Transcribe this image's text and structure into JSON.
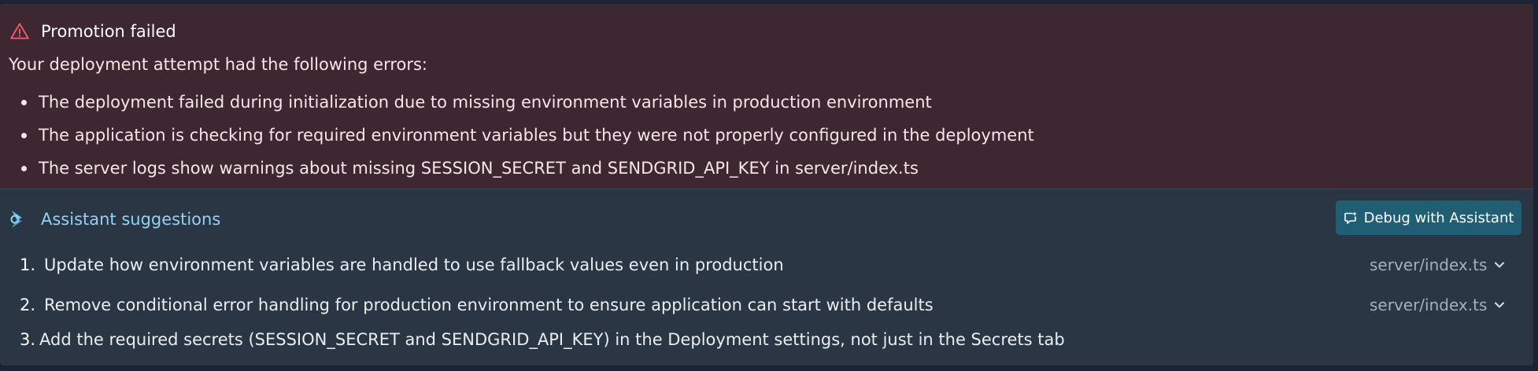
{
  "error": {
    "title": "Promotion failed",
    "intro": "Your deployment attempt had the following errors:",
    "items": [
      "The deployment failed during initialization due to missing environment variables in production environment",
      "The application is checking for required environment variables but they were not properly configured in the deployment",
      "The server logs show warnings about missing SESSION_SECRET and SENDGRID_API_KEY in server/index.ts"
    ],
    "icon": "warning-triangle-icon",
    "color": "#ef5a6a"
  },
  "assistant": {
    "title": "Assistant suggestions",
    "icon": "assistant-icon",
    "debug_button_label": "Debug with Assistant",
    "suggestions": [
      {
        "number": "1.",
        "text": "Update how environment variables are handled to use fallback values even in production",
        "file": "server/index.ts"
      },
      {
        "number": "2.",
        "text": "Remove conditional error handling for production environment to ensure application can start with defaults",
        "file": "server/index.ts"
      },
      {
        "number": "3.",
        "text": "Add the required secrets (SESSION_SECRET and SENDGRID_API_KEY) in the Deployment settings, not just in the Secrets tab"
      }
    ]
  },
  "colors": {
    "error_bg": "#3d2730",
    "panel_bg": "#2b3645",
    "accent": "#8fd2f1",
    "button_bg": "#1f5e73"
  }
}
